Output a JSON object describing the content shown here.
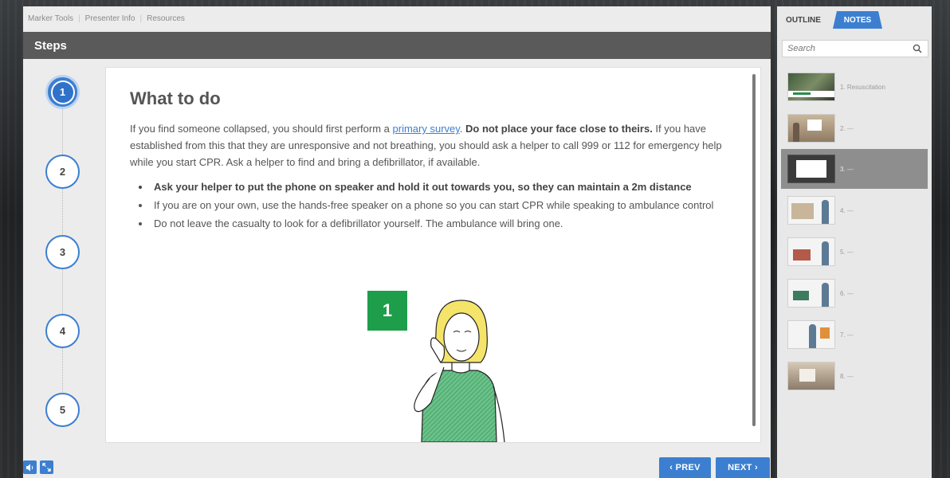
{
  "topnav": {
    "items": [
      "Marker Tools",
      "Presenter Info",
      "Resources"
    ]
  },
  "steps_header": "Steps",
  "steps": [
    "1",
    "2",
    "3",
    "4",
    "5"
  ],
  "content": {
    "title": "What to do",
    "intro_1": "If you find someone collapsed, you should first perform a ",
    "intro_link": "primary survey",
    "intro_2": ". ",
    "intro_bold": "Do not place your face close to theirs.",
    "intro_3": " If you have established from this that they are unresponsive and not breathing, you should ask a helper to call 999 or 112 for emergency help while you start CPR. Ask a helper to find and bring a defibrillator, if available.",
    "bullets": [
      "Ask your helper to put the phone on speaker and hold it out towards you, so they can maintain a 2m distance",
      "If you are on your own, use the hands-free speaker on a phone so you can start CPR while speaking to ambulance control",
      "Do not leave the casualty to look for a defibrillator yourself. The ambulance will bring one."
    ],
    "figure_badge": "1"
  },
  "controls": {
    "prev_label": "‹ PREV",
    "next_label": "NEXT ›"
  },
  "sidebar": {
    "tabs": [
      "OUTLINE",
      "NOTES"
    ],
    "search_placeholder": "Search",
    "slides": [
      {
        "label": "1. Resuscitation"
      },
      {
        "label": "2. ---"
      },
      {
        "label": "3. ---"
      },
      {
        "label": "4. ---"
      },
      {
        "label": "5. ---"
      },
      {
        "label": "6. ---"
      },
      {
        "label": "7. ---"
      },
      {
        "label": "8. ---"
      }
    ]
  },
  "colors": {
    "accent": "#3c7fd1",
    "header": "#5a5a5a",
    "badge_green": "#1e9e4a"
  }
}
